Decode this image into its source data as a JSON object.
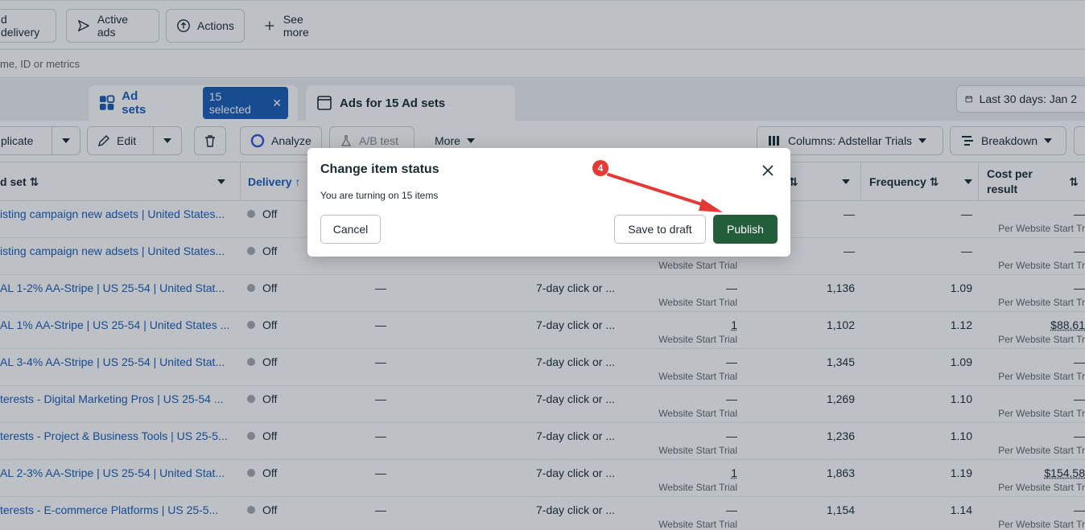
{
  "filters": {
    "delivery_label": "d delivery",
    "active_ads_label": "Active ads",
    "actions_label": "Actions",
    "see_more_label": "See more"
  },
  "search": {
    "placeholder": "me, ID or metrics"
  },
  "tabs": {
    "ad_sets_label": "Ad sets",
    "selected_label": "15 selected",
    "ads_label": "Ads for 15 Ad sets"
  },
  "date_range": {
    "label": "Last 30 days: Jan 2"
  },
  "toolbar": {
    "duplicate_label": "plicate",
    "edit_label": "Edit",
    "analyze_label": "Analyze",
    "ab_test_label": "A/B test",
    "more_label": "More",
    "columns_label": "Columns: Adstellar Trials",
    "breakdown_label": "Breakdown"
  },
  "table": {
    "headers": {
      "name": "d set",
      "delivery": "Delivery",
      "frequency": "Frequency",
      "cost_per_result": "Cost per\nresult"
    },
    "rows": [
      {
        "name": "isting campaign new adsets | United States...",
        "status": "Off",
        "bid": "",
        "attr": "",
        "results": "",
        "results_sub": "",
        "reach": "—",
        "freq": "—",
        "cpr": "—",
        "cpr_sub": "Per Website Start Trial"
      },
      {
        "name": "isting campaign new adsets | United States...",
        "status": "Off",
        "bid": "",
        "attr": "",
        "results": "",
        "results_sub": "Website Start Trial",
        "reach": "—",
        "freq": "—",
        "cpr": "—",
        "cpr_sub": "Per Website Start Trial"
      },
      {
        "name": "AL 1-2% AA-Stripe | US 25-54 | United Stat...",
        "status": "Off",
        "bid": "—",
        "attr": "7-day click or ...",
        "results": "—",
        "results_sub": "Website Start Trial",
        "reach": "1,136",
        "freq": "1.09",
        "cpr": "—",
        "cpr_sub": "Per Website Start Trial"
      },
      {
        "name": "AL 1% AA-Stripe | US 25-54 | United States ...",
        "status": "Off",
        "bid": "—",
        "attr": "7-day click or ...",
        "results": "1",
        "results_sub": "Website Start Trial",
        "reach": "1,102",
        "freq": "1.12",
        "cpr": "$88.61",
        "cpr_sub": "Per Website Start Trial"
      },
      {
        "name": "AL 3-4% AA-Stripe | US 25-54 | United Stat...",
        "status": "Off",
        "bid": "—",
        "attr": "7-day click or ...",
        "results": "—",
        "results_sub": "Website Start Trial",
        "reach": "1,345",
        "freq": "1.09",
        "cpr": "—",
        "cpr_sub": "Per Website Start Trial"
      },
      {
        "name": "terests - Digital Marketing Pros | US 25-54 ...",
        "status": "Off",
        "bid": "—",
        "attr": "7-day click or ...",
        "results": "—",
        "results_sub": "Website Start Trial",
        "reach": "1,269",
        "freq": "1.10",
        "cpr": "—",
        "cpr_sub": "Per Website Start Trial"
      },
      {
        "name": "terests - Project & Business Tools | US 25-5...",
        "status": "Off",
        "bid": "—",
        "attr": "7-day click or ...",
        "results": "—",
        "results_sub": "Website Start Trial",
        "reach": "1,236",
        "freq": "1.10",
        "cpr": "—",
        "cpr_sub": "Per Website Start Trial"
      },
      {
        "name": "AL 2-3% AA-Stripe | US 25-54 | United Stat...",
        "status": "Off",
        "bid": "—",
        "attr": "7-day click or ...",
        "results": "1",
        "results_sub": "Website Start Trial",
        "reach": "1,863",
        "freq": "1.19",
        "cpr": "$154.58",
        "cpr_sub": "Per Website Start Trial"
      },
      {
        "name": "terests - E-commerce Platforms | US 25-5...",
        "status": "Off",
        "bid": "—",
        "attr": "7-day click or ...",
        "results": "—",
        "results_sub": "Website Start Trial",
        "reach": "1,154",
        "freq": "1.14",
        "cpr": "—",
        "cpr_sub": "Per Website Start Trial"
      }
    ]
  },
  "modal": {
    "title": "Change item status",
    "message": "You are turning on 15 items",
    "cancel_label": "Cancel",
    "draft_label": "Save to draft",
    "publish_label": "Publish",
    "step_badge": "4"
  },
  "colors": {
    "publish_green": "#245d3a",
    "link_blue": "#1b5fb8",
    "badge_red": "#e53935"
  }
}
